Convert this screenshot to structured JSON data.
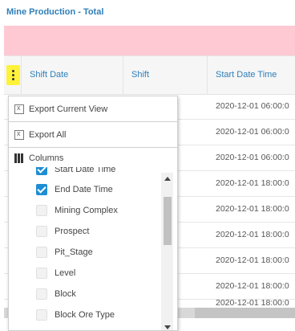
{
  "page": {
    "title": "Mine Production - Total"
  },
  "grid": {
    "columns": [
      {
        "label": "Shift Date"
      },
      {
        "label": "Shift"
      },
      {
        "label": "Start Date Time"
      }
    ],
    "rows": [
      {
        "start": "2020-12-01 06:00:0"
      },
      {
        "start": "2020-12-01 06:00:0"
      },
      {
        "start": "2020-12-01 06:00:0"
      },
      {
        "start": "2020-12-01 18:00:0"
      },
      {
        "start": "2020-12-01 18:00:0"
      },
      {
        "start": "2020-12-01 18:00:0"
      },
      {
        "start": "2020-12-01 18:00:0"
      },
      {
        "start": "2020-12-01 18:00:0"
      },
      {
        "start": "2020-12-01 18:00:0"
      }
    ]
  },
  "menu": {
    "export_current": "Export Current View",
    "export_all": "Export All",
    "columns": "Columns",
    "column_items": [
      {
        "label": "Start Date Time",
        "checked": true
      },
      {
        "label": "End Date Time",
        "checked": true
      },
      {
        "label": "Mining Complex",
        "checked": false
      },
      {
        "label": "Prospect",
        "checked": false
      },
      {
        "label": "Pit_Stage",
        "checked": false
      },
      {
        "label": "Level",
        "checked": false
      },
      {
        "label": "Block",
        "checked": false
      },
      {
        "label": "Block Ore Type",
        "checked": false
      }
    ]
  },
  "colors": {
    "accent": "#2f7fb8",
    "banner": "#ffc9d4",
    "checkbox": "#1e8ed4",
    "handle": "#fff23a"
  }
}
